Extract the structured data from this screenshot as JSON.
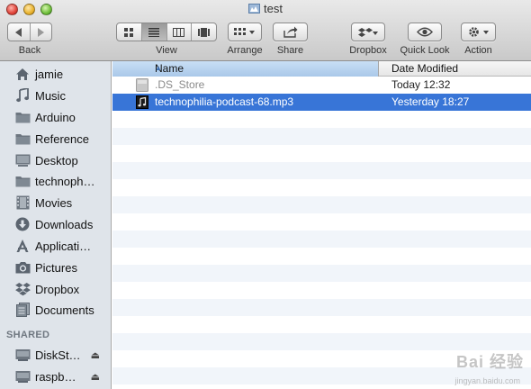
{
  "window": {
    "title": "test"
  },
  "toolbar": {
    "back_label": "Back",
    "view_label": "View",
    "arrange_label": "Arrange",
    "share_label": "Share",
    "dropbox_label": "Dropbox",
    "quicklook_label": "Quick Look",
    "action_label": "Action"
  },
  "sidebar": {
    "favorites": [
      {
        "label": "jamie",
        "icon": "home-icon"
      },
      {
        "label": "Music",
        "icon": "music-note-icon"
      },
      {
        "label": "Arduino",
        "icon": "folder-icon"
      },
      {
        "label": "Reference",
        "icon": "folder-icon"
      },
      {
        "label": "Desktop",
        "icon": "desktop-icon"
      },
      {
        "label": "technoph…",
        "icon": "folder-icon"
      },
      {
        "label": "Movies",
        "icon": "film-icon"
      },
      {
        "label": "Downloads",
        "icon": "download-icon"
      },
      {
        "label": "Applicati…",
        "icon": "applications-icon"
      },
      {
        "label": "Pictures",
        "icon": "camera-icon"
      },
      {
        "label": "Dropbox",
        "icon": "dropbox-icon"
      },
      {
        "label": "Documents",
        "icon": "documents-icon"
      }
    ],
    "shared_header": "SHARED",
    "shared": [
      {
        "label": "DiskSt…",
        "icon": "network-drive-icon"
      },
      {
        "label": "raspb…",
        "icon": "network-drive-icon"
      }
    ]
  },
  "filelist": {
    "columns": {
      "name": "Name",
      "date": "Date Modified"
    },
    "rows": [
      {
        "name": ".DS_Store",
        "date": "Today 12:32",
        "selected": false,
        "icon": "generic-file-icon"
      },
      {
        "name": "technophilia-podcast-68.mp3",
        "date": "Yesterday 18:27",
        "selected": true,
        "icon": "audio-file-icon"
      }
    ]
  },
  "colors": {
    "selection": "#3875d7",
    "sidebar_bg": "#dfe4ea",
    "row_alt": "#f1f5fa"
  },
  "watermark": {
    "text": "Bai 经验",
    "url": "jingyan.baidu.com"
  }
}
